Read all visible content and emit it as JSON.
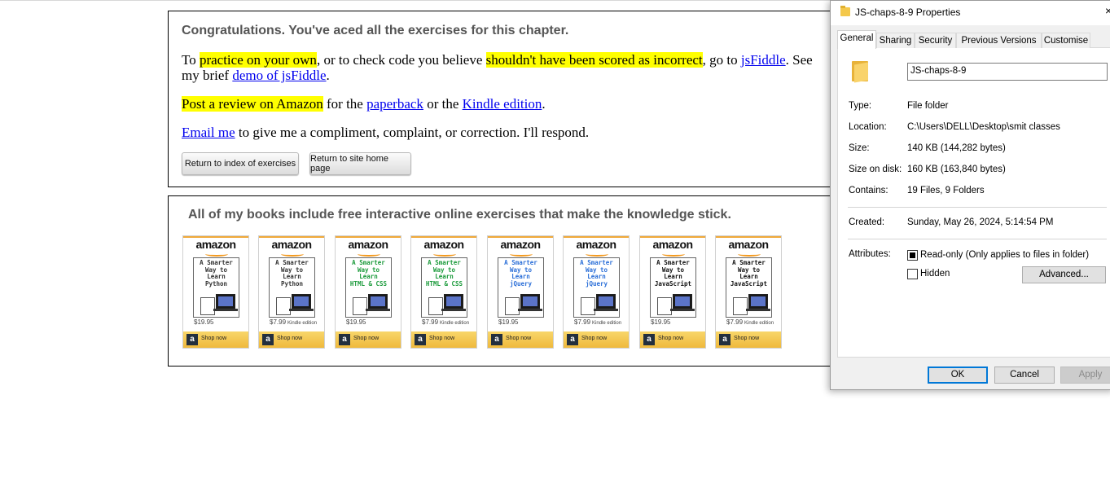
{
  "page": {
    "congrats": "Congratulations. You've aced all the exercises for this chapter.",
    "p1": {
      "t1": "To ",
      "hl1": "practice on your own",
      "t2": ", or to check code you believe ",
      "hl2": "shouldn't have been scored as incorrect",
      "t3": ", go to ",
      "link1": "jsFiddle",
      "t4": ". See",
      "t5": "my brief ",
      "link2": "demo of jsFiddle",
      "t6": "."
    },
    "p2": {
      "hl": "Post a review on Amazon",
      "t1": " for the ",
      "link1": "paperback",
      "t2": " or the ",
      "link2": "Kindle edition",
      "t3": "."
    },
    "p3": {
      "link": "Email me",
      "t1": " to give me a compliment, complaint, or correction. I'll respond."
    },
    "buttons": {
      "index": "Return to index of exercises",
      "home": "Return to site home page"
    }
  },
  "books": {
    "heading": "All of my books include free interactive online exercises that make the knowledge stick.",
    "logo_text": "amazon",
    "shop_label": "Shop now",
    "shop_icon": "a",
    "items": [
      {
        "title_lines": [
          "A Smarter",
          "Way to",
          "Learn",
          "Python"
        ],
        "title_color": "#333333",
        "price": "$19.95",
        "kind": ""
      },
      {
        "title_lines": [
          "A Smarter",
          "Way to",
          "Learn",
          "Python"
        ],
        "title_color": "#333333",
        "price": "$7.99",
        "kind": "Kindle edition"
      },
      {
        "title_lines": [
          "A Smarter",
          "Way to",
          "Learn",
          "HTML & CSS"
        ],
        "title_color": "#1a9a3a",
        "price": "$19.95",
        "kind": ""
      },
      {
        "title_lines": [
          "A Smarter",
          "Way to",
          "Learn",
          "HTML & CSS"
        ],
        "title_color": "#1a9a3a",
        "price": "$7.99",
        "kind": "Kindle edition"
      },
      {
        "title_lines": [
          "A Smarter",
          "Way to",
          "Learn",
          "jQuery"
        ],
        "title_color": "#2b6fd8",
        "price": "$19.95",
        "kind": ""
      },
      {
        "title_lines": [
          "A Smarter",
          "Way to",
          "Learn",
          "jQuery"
        ],
        "title_color": "#2b6fd8",
        "price": "$7.99",
        "kind": "Kindle edition"
      },
      {
        "title_lines": [
          "A Smarter",
          "Way to",
          "Learn",
          "JavaScript"
        ],
        "title_color": "#111111",
        "price": "$19.95",
        "kind": ""
      },
      {
        "title_lines": [
          "A Smarter",
          "Way to",
          "Learn",
          "JavaScript"
        ],
        "title_color": "#111111",
        "price": "$7.99",
        "kind": "Kindle edition"
      }
    ]
  },
  "dialog": {
    "title": "JS-chaps-8-9 Properties",
    "close": "×",
    "tabs": [
      "General",
      "Sharing",
      "Security",
      "Previous Versions",
      "Customise"
    ],
    "name_value": "JS-chaps-8-9",
    "rows": {
      "type": {
        "label": "Type:",
        "value": "File folder"
      },
      "location": {
        "label": "Location:",
        "value": "C:\\Users\\DELL\\Desktop\\smit classes"
      },
      "size": {
        "label": "Size:",
        "value": "140 KB (144,282 bytes)"
      },
      "size_on_disk": {
        "label": "Size on disk:",
        "value": "160 KB (163,840 bytes)"
      },
      "contains": {
        "label": "Contains:",
        "value": "19 Files, 9 Folders"
      },
      "created": {
        "label": "Created:",
        "value": "Sunday, May 26, 2024, 5:14:54 PM"
      },
      "attributes": {
        "label": "Attributes:"
      }
    },
    "readonly_label": "Read-only (Only applies to files in folder)",
    "hidden_label": "Hidden",
    "advanced_label": "Advanced...",
    "buttons": {
      "ok": "OK",
      "cancel": "Cancel",
      "apply": "Apply"
    }
  }
}
